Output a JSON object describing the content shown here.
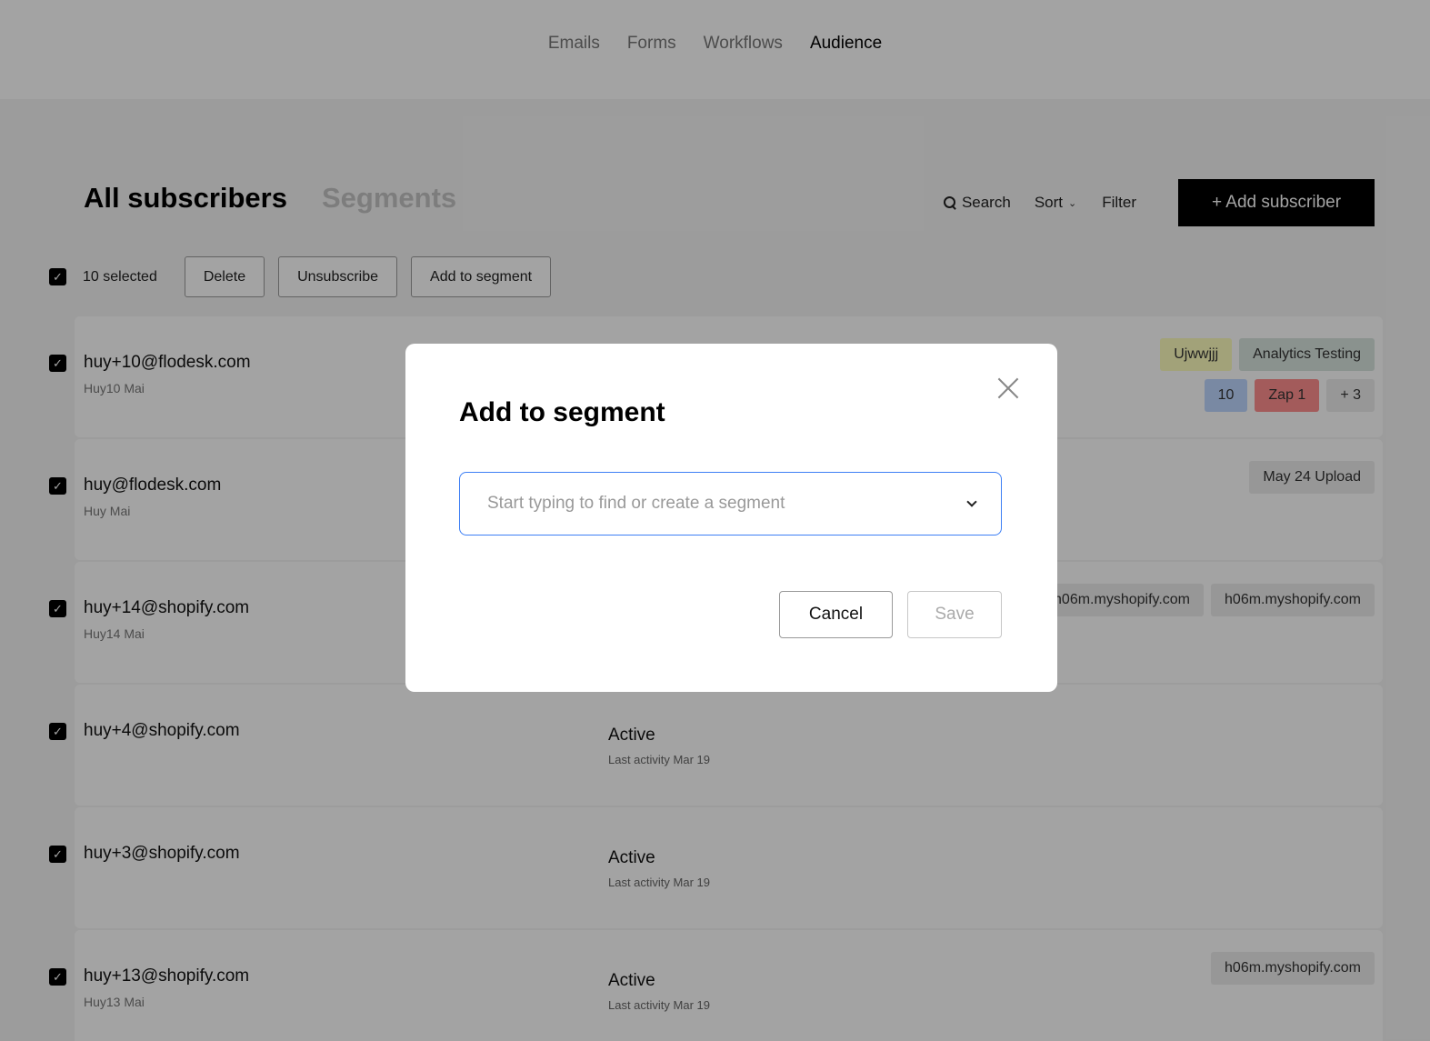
{
  "nav": {
    "items": [
      {
        "label": "Emails",
        "active": false
      },
      {
        "label": "Forms",
        "active": false
      },
      {
        "label": "Workflows",
        "active": false
      },
      {
        "label": "Audience",
        "active": true
      }
    ]
  },
  "header": {
    "tab_all": "All subscribers",
    "tab_segments": "Segments",
    "search_label": "Search",
    "sort_label": "Sort",
    "filter_label": "Filter",
    "add_label": "+ Add subscriber"
  },
  "bulk": {
    "selected_text": "10 selected",
    "delete_label": "Delete",
    "unsubscribe_label": "Unsubscribe",
    "add_to_segment_label": "Add to segment"
  },
  "rows": [
    {
      "email": "huy+10@flodesk.com",
      "name": "Huy10 Mai",
      "status": "",
      "activity": "",
      "tag_lines": [
        [
          {
            "label": "Ujwwjjj",
            "color": "#fefebe",
            "text": "#333"
          },
          {
            "label": "Analytics Testing",
            "color": "#d8e4de",
            "text": "#333"
          }
        ],
        [
          {
            "label": "10",
            "color": "#bed6ff",
            "text": "#333"
          },
          {
            "label": "Zap 1",
            "color": "#ff8f8f",
            "text": "#333"
          },
          {
            "label": "+ 3",
            "color": "#ededed",
            "text": "#333"
          }
        ]
      ]
    },
    {
      "email": "huy@flodesk.com",
      "name": "Huy Mai",
      "status": "",
      "activity": "",
      "tag_lines": [
        [
          {
            "label": "May 24 Upload",
            "color": "#ededed",
            "text": "#333"
          }
        ]
      ]
    },
    {
      "email": "huy+14@shopify.com",
      "name": "Huy14 Mai",
      "status": "",
      "activity": "",
      "tag_lines": [
        [
          {
            "label": "h06m.myshopify.com",
            "color": "#ededed",
            "text": "#333"
          },
          {
            "label": "h06m.myshopify.com",
            "color": "#ededed",
            "text": "#333"
          }
        ]
      ]
    },
    {
      "email": "huy+4@shopify.com",
      "name": "",
      "status": "Active",
      "activity": "Last activity Mar 19",
      "tag_lines": []
    },
    {
      "email": "huy+3@shopify.com",
      "name": "",
      "status": "Active",
      "activity": "Last activity Mar 19",
      "tag_lines": []
    },
    {
      "email": "huy+13@shopify.com",
      "name": "Huy13 Mai",
      "status": "Active",
      "activity": "Last activity Mar 19",
      "tag_lines": [
        [
          {
            "label": "h06m.myshopify.com",
            "color": "#ededed",
            "text": "#333"
          }
        ]
      ]
    }
  ],
  "modal": {
    "title": "Add to segment",
    "close_icon": "close-icon",
    "placeholder": "Start typing to find or create a segment",
    "value": "",
    "cancel_label": "Cancel",
    "save_label": "Save"
  },
  "checkbox_mark": "✓"
}
